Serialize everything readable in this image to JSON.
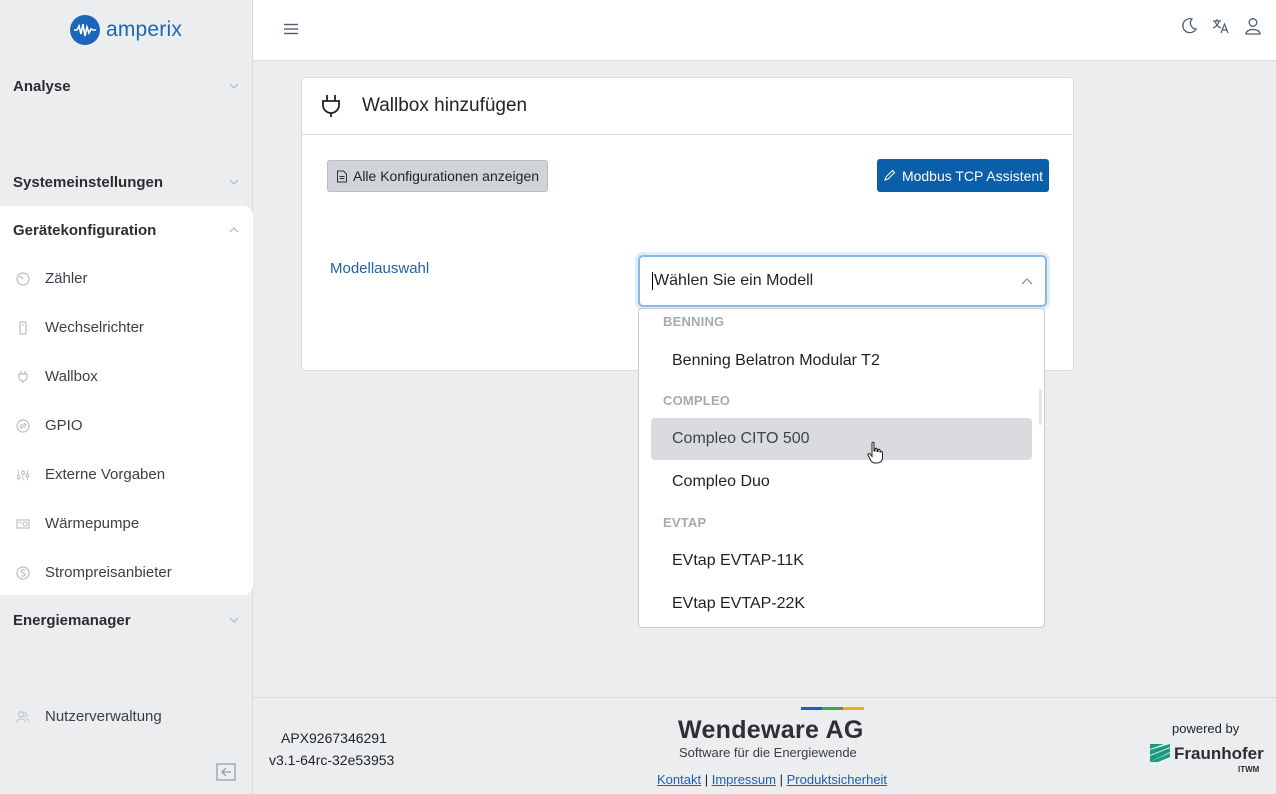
{
  "brand": {
    "name": "amperix"
  },
  "sidebar": {
    "groups": [
      {
        "label": "Analyse"
      },
      {
        "label": "Systemeinstellungen"
      },
      {
        "label": "Gerätekonfiguration"
      },
      {
        "label": "Energiemanager"
      }
    ],
    "device_items": [
      {
        "label": "Zähler",
        "icon": "gauge-icon"
      },
      {
        "label": "Wechselrichter",
        "icon": "inverter-icon"
      },
      {
        "label": "Wallbox",
        "icon": "plug-icon"
      },
      {
        "label": "GPIO",
        "icon": "gpio-icon"
      },
      {
        "label": "Externe Vorgaben",
        "icon": "sliders-icon"
      },
      {
        "label": "Wärmepumpe",
        "icon": "heatpump-icon"
      },
      {
        "label": "Strompreisanbieter",
        "icon": "price-icon"
      }
    ],
    "user_management": "Nutzerverwaltung"
  },
  "card": {
    "title": "Wallbox hinzufügen",
    "show_configs_label": "Alle Konfigurationen anzeigen",
    "modbus_label": "Modbus TCP Assistent",
    "field_label": "Modellauswahl",
    "select_placeholder": "Wählen Sie ein Modell"
  },
  "dropdown": {
    "groups": [
      "BENNING",
      "COMPLEO",
      "EVTAP"
    ],
    "options": [
      "Benning Belatron Modular T2",
      "Compleo CITO 500",
      "Compleo Duo",
      "EVtap EVTAP-11K",
      "EVtap EVTAP-22K"
    ],
    "hovered": "Compleo CITO 500"
  },
  "footer": {
    "serial": "APX9267346291",
    "version": "v3.1-64rc-32e53953",
    "company": "Wendeware AG",
    "tagline": "Software für die Energiewende",
    "links": [
      "Kontakt",
      "Impressum",
      "Produktsicherheit"
    ],
    "powered_by": "powered by",
    "partner": "Fraunhofer",
    "partner_sub": "ITWM"
  },
  "colors": {
    "accent": "#0b5eaa",
    "brand": "#1a66b8",
    "bar_blue": "#1a5fb4",
    "bar_green": "#3aa35b",
    "bar_yellow": "#f0b400"
  }
}
